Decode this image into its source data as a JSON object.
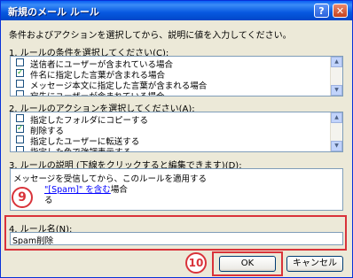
{
  "window": {
    "title": "新規のメール ルール",
    "help_glyph": "?",
    "close_glyph": "✕"
  },
  "instruction": "条件およびアクションを選択してから、説明に値を入力してください。",
  "conditions": {
    "label": "1. ルールの条件を選択してください(C):",
    "items": [
      {
        "label": "送信者にユーザーが含まれている場合",
        "checked": false
      },
      {
        "label": "件名に指定した言葉が含まれる場合",
        "checked": true
      },
      {
        "label": "メッセージ本文に指定した言葉が含まれる場合",
        "checked": false
      },
      {
        "label": "宛先にユーザーが含まれている場合",
        "checked": false
      }
    ]
  },
  "actions": {
    "label": "2. ルールのアクションを選択してください(A):",
    "items": [
      {
        "label": "指定したフォルダにコピーする",
        "checked": false
      },
      {
        "label": "削除する",
        "checked": true
      },
      {
        "label": "指定したユーザーに転送する",
        "checked": false
      },
      {
        "label": "指定した色で強調表示する",
        "checked": false
      }
    ]
  },
  "description": {
    "label": "3. ルールの説明 (下線をクリックすると編集できます)(D):",
    "line1": "メッセージを受信してから、このルールを適用する",
    "line2_link": "\"[Spam]\" を含む",
    "line2_suffix": "場合",
    "line3": "る"
  },
  "rule_name": {
    "label": "4. ルール名(N):",
    "value": "Spam削除"
  },
  "buttons": {
    "ok": "OK",
    "cancel": "キャンセル"
  },
  "annotations": {
    "badge9": "9",
    "badge10": "10"
  },
  "check_glyph": "✓",
  "scroll": {
    "up": "▲",
    "down": "▼"
  }
}
